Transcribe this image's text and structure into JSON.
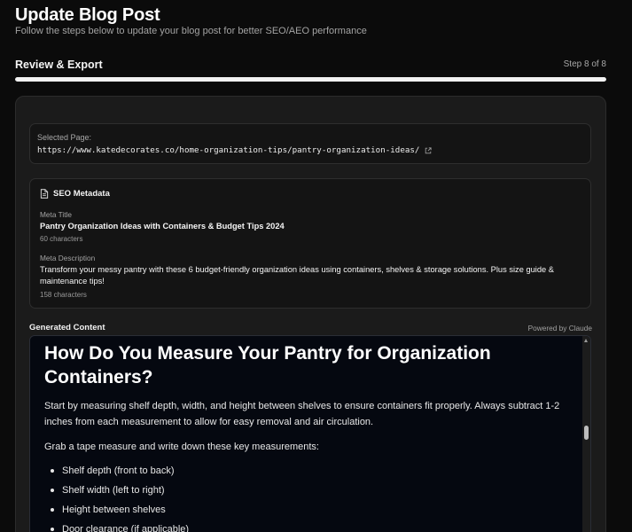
{
  "header": {
    "title": "Update Blog Post",
    "subtitle": "Follow the steps below to update your blog post for better SEO/AEO performance"
  },
  "step": {
    "title": "Review & Export",
    "counter": "Step 8 of 8",
    "progress_fraction": 1.0
  },
  "selected_page": {
    "label": "Selected Page:",
    "url": "https://www.katedecorates.co/home-organization-tips/pantry-organization-ideas/"
  },
  "seo": {
    "heading": "SEO Metadata",
    "meta_title_label": "Meta Title",
    "meta_title": "Pantry Organization Ideas with Containers & Budget Tips 2024",
    "meta_title_count": "60 characters",
    "meta_description_label": "Meta Description",
    "meta_description": "Transform your messy pantry with these 6 budget-friendly organization ideas using containers, shelves & storage solutions. Plus size guide & maintenance tips!",
    "meta_description_count": "158 characters"
  },
  "generated": {
    "label": "Generated Content",
    "powered_by": "Powered by Claude",
    "heading": "How Do You Measure Your Pantry for Organization Containers?",
    "paragraph1": "Start by measuring shelf depth, width, and height between shelves to ensure containers fit properly. Always subtract 1-2 inches from each measurement to allow for easy removal and air circulation.",
    "paragraph2": "Grab a tape measure and write down these key measurements:",
    "list": [
      "Shelf depth (front to back)",
      "Shelf width (left to right)",
      "Height between shelves",
      "Door clearance (if applicable)"
    ]
  },
  "colors": {
    "background": "#0b0b0b",
    "card": "#1b1b1b",
    "content_bg": "#050810",
    "progress_fill": "#f2f2f2"
  }
}
